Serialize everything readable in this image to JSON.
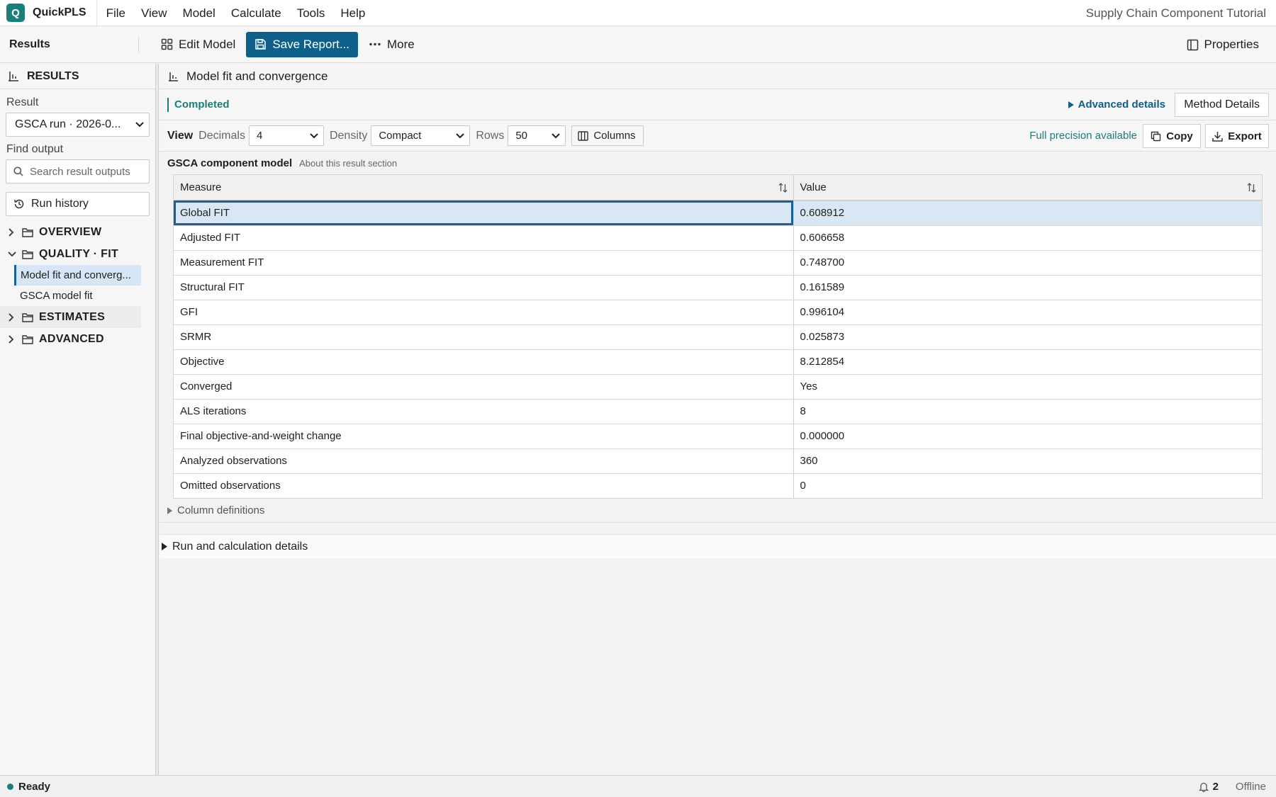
{
  "app": {
    "logo_letter": "Q",
    "name": "QuickPLS",
    "project_title": "Supply Chain Component Tutorial"
  },
  "menu": [
    "File",
    "View",
    "Model",
    "Calculate",
    "Tools",
    "Help"
  ],
  "toolbar": {
    "title": "Results",
    "edit_model": "Edit Model",
    "save_report": "Save Report...",
    "more": "More",
    "properties": "Properties"
  },
  "sidebar": {
    "header": "RESULTS",
    "result_label": "Result",
    "result_value": "GSCA run · 2026-0...",
    "find_label": "Find output",
    "search_placeholder": "Search result outputs",
    "run_history": "Run history",
    "tree": [
      {
        "label": "OVERVIEW",
        "expanded": false,
        "children": []
      },
      {
        "label": "QUALITY · FIT",
        "expanded": true,
        "children": [
          "Model fit and converg...",
          "GSCA model fit"
        ]
      },
      {
        "label": "ESTIMATES",
        "expanded": false,
        "children": []
      },
      {
        "label": "ADVANCED",
        "expanded": false,
        "children": []
      }
    ]
  },
  "main": {
    "section_title": "Model fit and convergence",
    "status": "Completed",
    "advanced_details": "Advanced details",
    "method_details": "Method Details",
    "view": {
      "label": "View",
      "decimals_label": "Decimals",
      "decimals_value": "4",
      "density_label": "Density",
      "density_value": "Compact",
      "rows_label": "Rows",
      "rows_value": "50",
      "columns_button": "Columns",
      "precision_note": "Full precision available",
      "copy": "Copy",
      "export": "Export"
    },
    "model_name": "GSCA component model",
    "model_about": "About this result section",
    "table": {
      "columns": [
        "Measure",
        "Value"
      ],
      "rows": [
        [
          "Global FIT",
          "0.608912"
        ],
        [
          "Adjusted FIT",
          "0.606658"
        ],
        [
          "Measurement FIT",
          "0.748700"
        ],
        [
          "Structural FIT",
          "0.161589"
        ],
        [
          "GFI",
          "0.996104"
        ],
        [
          "SRMR",
          "0.025873"
        ],
        [
          "Objective",
          "8.212854"
        ],
        [
          "Converged",
          "Yes"
        ],
        [
          "ALS iterations",
          "8"
        ],
        [
          "Final objective-and-weight change",
          "0.000000"
        ],
        [
          "Analyzed observations",
          "360"
        ],
        [
          "Omitted observations",
          "0"
        ]
      ],
      "selected_row": 0
    },
    "column_definitions": "Column definitions",
    "run_details": "Run and calculation details"
  },
  "statusbar": {
    "status": "Ready",
    "notifications": "2",
    "connection": "Offline"
  },
  "colors": {
    "accent": "#1a7f7a",
    "primary": "#0e5f8a",
    "selection": "#d8e7f3"
  }
}
